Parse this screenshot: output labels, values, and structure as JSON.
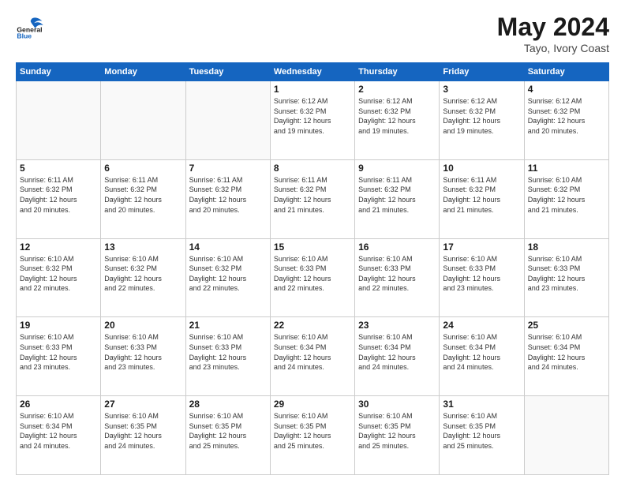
{
  "header": {
    "logo_general": "General",
    "logo_blue": "Blue",
    "month": "May 2024",
    "location": "Tayo, Ivory Coast"
  },
  "weekdays": [
    "Sunday",
    "Monday",
    "Tuesday",
    "Wednesday",
    "Thursday",
    "Friday",
    "Saturday"
  ],
  "weeks": [
    [
      {
        "day": "",
        "info": ""
      },
      {
        "day": "",
        "info": ""
      },
      {
        "day": "",
        "info": ""
      },
      {
        "day": "1",
        "info": "Sunrise: 6:12 AM\nSunset: 6:32 PM\nDaylight: 12 hours\nand 19 minutes."
      },
      {
        "day": "2",
        "info": "Sunrise: 6:12 AM\nSunset: 6:32 PM\nDaylight: 12 hours\nand 19 minutes."
      },
      {
        "day": "3",
        "info": "Sunrise: 6:12 AM\nSunset: 6:32 PM\nDaylight: 12 hours\nand 19 minutes."
      },
      {
        "day": "4",
        "info": "Sunrise: 6:12 AM\nSunset: 6:32 PM\nDaylight: 12 hours\nand 20 minutes."
      }
    ],
    [
      {
        "day": "5",
        "info": "Sunrise: 6:11 AM\nSunset: 6:32 PM\nDaylight: 12 hours\nand 20 minutes."
      },
      {
        "day": "6",
        "info": "Sunrise: 6:11 AM\nSunset: 6:32 PM\nDaylight: 12 hours\nand 20 minutes."
      },
      {
        "day": "7",
        "info": "Sunrise: 6:11 AM\nSunset: 6:32 PM\nDaylight: 12 hours\nand 20 minutes."
      },
      {
        "day": "8",
        "info": "Sunrise: 6:11 AM\nSunset: 6:32 PM\nDaylight: 12 hours\nand 21 minutes."
      },
      {
        "day": "9",
        "info": "Sunrise: 6:11 AM\nSunset: 6:32 PM\nDaylight: 12 hours\nand 21 minutes."
      },
      {
        "day": "10",
        "info": "Sunrise: 6:11 AM\nSunset: 6:32 PM\nDaylight: 12 hours\nand 21 minutes."
      },
      {
        "day": "11",
        "info": "Sunrise: 6:10 AM\nSunset: 6:32 PM\nDaylight: 12 hours\nand 21 minutes."
      }
    ],
    [
      {
        "day": "12",
        "info": "Sunrise: 6:10 AM\nSunset: 6:32 PM\nDaylight: 12 hours\nand 22 minutes."
      },
      {
        "day": "13",
        "info": "Sunrise: 6:10 AM\nSunset: 6:32 PM\nDaylight: 12 hours\nand 22 minutes."
      },
      {
        "day": "14",
        "info": "Sunrise: 6:10 AM\nSunset: 6:32 PM\nDaylight: 12 hours\nand 22 minutes."
      },
      {
        "day": "15",
        "info": "Sunrise: 6:10 AM\nSunset: 6:33 PM\nDaylight: 12 hours\nand 22 minutes."
      },
      {
        "day": "16",
        "info": "Sunrise: 6:10 AM\nSunset: 6:33 PM\nDaylight: 12 hours\nand 22 minutes."
      },
      {
        "day": "17",
        "info": "Sunrise: 6:10 AM\nSunset: 6:33 PM\nDaylight: 12 hours\nand 23 minutes."
      },
      {
        "day": "18",
        "info": "Sunrise: 6:10 AM\nSunset: 6:33 PM\nDaylight: 12 hours\nand 23 minutes."
      }
    ],
    [
      {
        "day": "19",
        "info": "Sunrise: 6:10 AM\nSunset: 6:33 PM\nDaylight: 12 hours\nand 23 minutes."
      },
      {
        "day": "20",
        "info": "Sunrise: 6:10 AM\nSunset: 6:33 PM\nDaylight: 12 hours\nand 23 minutes."
      },
      {
        "day": "21",
        "info": "Sunrise: 6:10 AM\nSunset: 6:33 PM\nDaylight: 12 hours\nand 23 minutes."
      },
      {
        "day": "22",
        "info": "Sunrise: 6:10 AM\nSunset: 6:34 PM\nDaylight: 12 hours\nand 24 minutes."
      },
      {
        "day": "23",
        "info": "Sunrise: 6:10 AM\nSunset: 6:34 PM\nDaylight: 12 hours\nand 24 minutes."
      },
      {
        "day": "24",
        "info": "Sunrise: 6:10 AM\nSunset: 6:34 PM\nDaylight: 12 hours\nand 24 minutes."
      },
      {
        "day": "25",
        "info": "Sunrise: 6:10 AM\nSunset: 6:34 PM\nDaylight: 12 hours\nand 24 minutes."
      }
    ],
    [
      {
        "day": "26",
        "info": "Sunrise: 6:10 AM\nSunset: 6:34 PM\nDaylight: 12 hours\nand 24 minutes."
      },
      {
        "day": "27",
        "info": "Sunrise: 6:10 AM\nSunset: 6:35 PM\nDaylight: 12 hours\nand 24 minutes."
      },
      {
        "day": "28",
        "info": "Sunrise: 6:10 AM\nSunset: 6:35 PM\nDaylight: 12 hours\nand 25 minutes."
      },
      {
        "day": "29",
        "info": "Sunrise: 6:10 AM\nSunset: 6:35 PM\nDaylight: 12 hours\nand 25 minutes."
      },
      {
        "day": "30",
        "info": "Sunrise: 6:10 AM\nSunset: 6:35 PM\nDaylight: 12 hours\nand 25 minutes."
      },
      {
        "day": "31",
        "info": "Sunrise: 6:10 AM\nSunset: 6:35 PM\nDaylight: 12 hours\nand 25 minutes."
      },
      {
        "day": "",
        "info": ""
      }
    ]
  ]
}
